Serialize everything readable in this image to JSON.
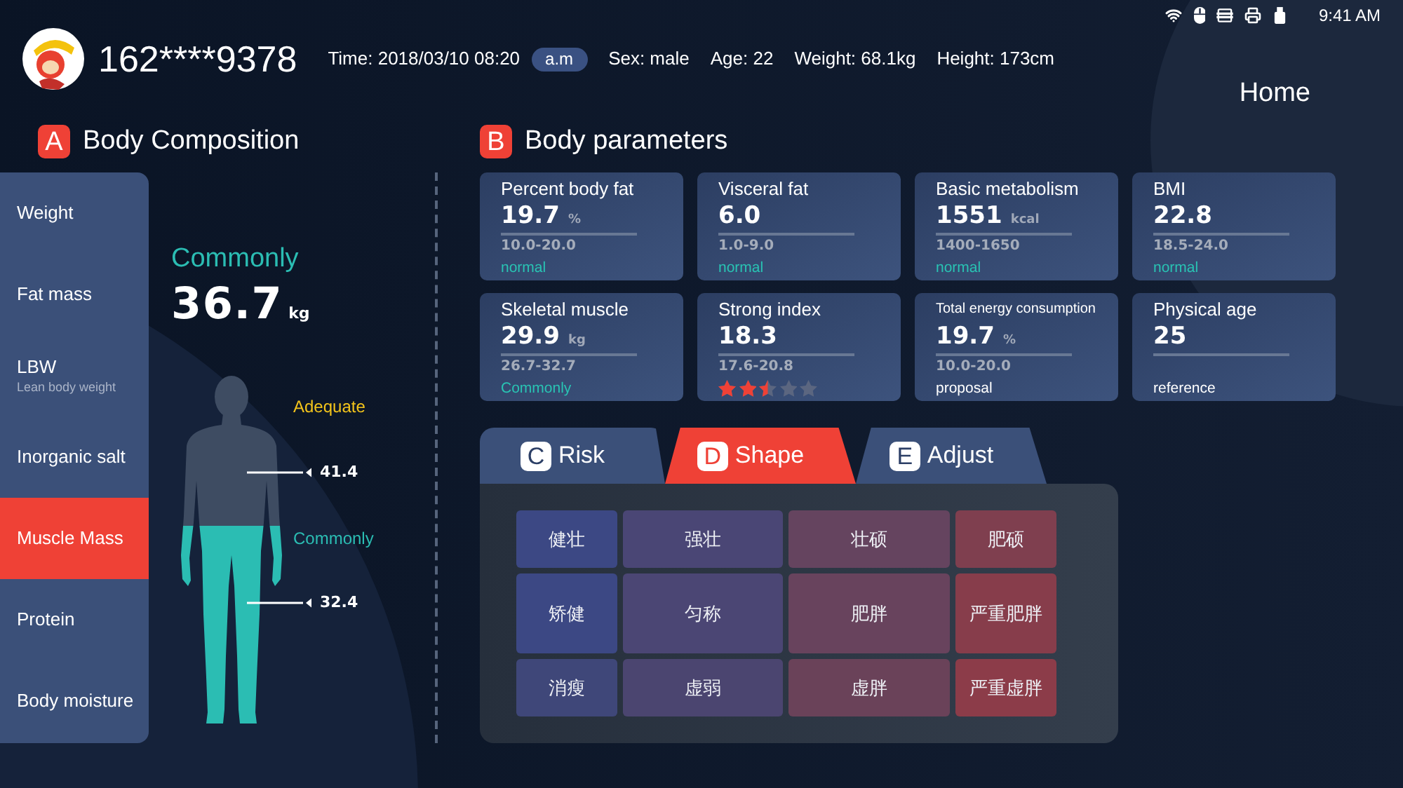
{
  "status_bar": {
    "time": "9:41 AM"
  },
  "header": {
    "phone": "162****9378",
    "time": "Time: 2018/03/10 08:20",
    "period": "a.m",
    "details": [
      "Sex: male",
      "Age: 22",
      "Weight: 68.1kg",
      "Height: 173cm"
    ]
  },
  "nav": {
    "home": "Home"
  },
  "composition": {
    "badge": "A",
    "title": "Body Composition",
    "items": [
      {
        "label": "Weight",
        "selected": false
      },
      {
        "label": "Fat mass",
        "selected": false
      },
      {
        "label": "LBW",
        "sublabel": "Lean body weight",
        "selected": false
      },
      {
        "label": "Inorganic salt",
        "selected": false
      },
      {
        "label": "Muscle Mass",
        "selected": true
      },
      {
        "label": "Protein",
        "selected": false
      },
      {
        "label": "Body moisture",
        "selected": false
      }
    ],
    "status": "Commonly",
    "value": "36.7",
    "unit": "kg",
    "markers": [
      {
        "label": "Adequate",
        "color": "#f2c31b",
        "value": "41.4"
      },
      {
        "label": "Commonly",
        "color": "#2bbdb3",
        "value": "32.4"
      }
    ]
  },
  "parameters": {
    "badge": "B",
    "title": "Body parameters",
    "cards": [
      {
        "title": "Percent body fat",
        "value": "19.7",
        "unit": "%",
        "range": "10.0-20.0",
        "kind": "status",
        "status": "normal"
      },
      {
        "title": "Visceral fat",
        "value": "6.0",
        "range": "1.0-9.0",
        "kind": "status",
        "status": "normal"
      },
      {
        "title": "Basic metabolism",
        "value": "1551",
        "unit": "kcal",
        "range": "1400-1650",
        "kind": "status",
        "status": "normal"
      },
      {
        "title": "BMI",
        "value": "22.8",
        "range": "18.5-24.0",
        "kind": "status",
        "status": "normal"
      },
      {
        "title": "Skeletal muscle",
        "value": "29.9",
        "unit": "kg",
        "range": "26.7-32.7",
        "kind": "status",
        "status": "Commonly"
      },
      {
        "title": "Strong index",
        "value": "18.3",
        "range": "17.6-20.8",
        "kind": "stars",
        "stars": 2.5
      },
      {
        "title": "Total energy consumption",
        "small_title": true,
        "value": "19.7",
        "unit": "%",
        "range": "10.0-20.0",
        "kind": "note",
        "status": "proposal"
      },
      {
        "title": "Physical age",
        "value": "25",
        "kind": "note",
        "status": "reference"
      }
    ]
  },
  "tabs": [
    {
      "badge": "C",
      "label": "Risk",
      "selected": false
    },
    {
      "badge": "D",
      "label": "Shape",
      "selected": true
    },
    {
      "badge": "E",
      "label": "Adjust",
      "selected": false
    }
  ],
  "shape_grid": {
    "rows": [
      {
        "cells": [
          {
            "label": "健壮",
            "color": "#3c4884"
          },
          {
            "label": "强壮",
            "color": "#4a4675"
          },
          {
            "label": "壮硕",
            "color": "#65445f"
          },
          {
            "label": "肥硕",
            "color": "#7f3f4f"
          }
        ]
      },
      {
        "cells": [
          {
            "label": "矫健",
            "color": "#3c4884"
          },
          {
            "label": "匀称",
            "color": "#4b4674"
          },
          {
            "label": "肥胖",
            "color": "#68435d"
          },
          {
            "label": "严重肥胖",
            "color": "#873d4b"
          }
        ]
      },
      {
        "cells": [
          {
            "label": "消瘦",
            "color": "#3f4779"
          },
          {
            "label": "虚弱",
            "color": "#4b4570"
          },
          {
            "label": "虚胖",
            "color": "#6a4259"
          },
          {
            "label": "严重虚胖",
            "color": "#8c3c49"
          }
        ]
      }
    ]
  }
}
